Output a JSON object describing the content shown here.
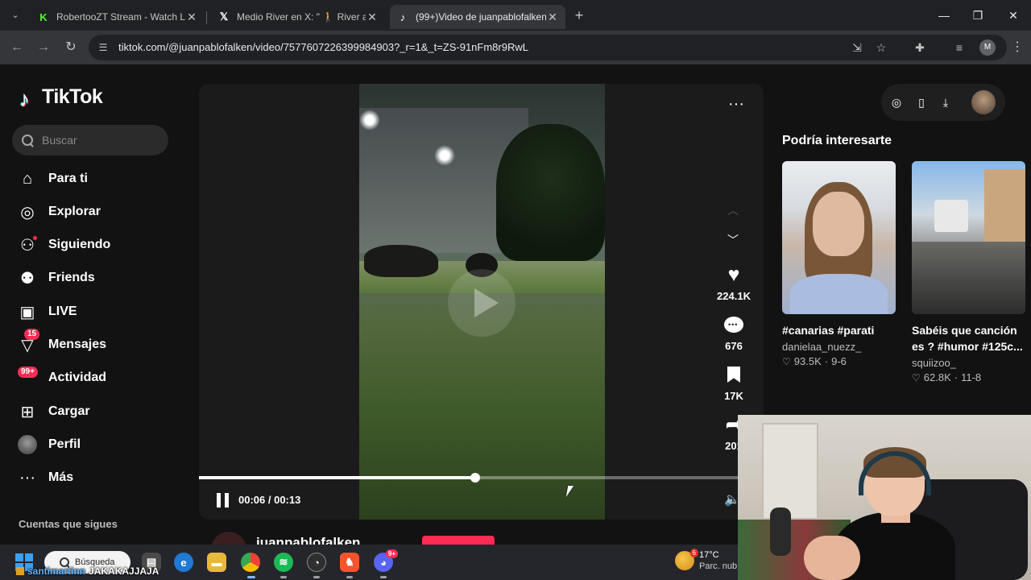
{
  "browser": {
    "tabs": [
      {
        "title": "RobertooZT Stream - Watch Liv",
        "icon": "kick-icon",
        "active": false
      },
      {
        "title": "Medio River en X: \" 🚶 River ave",
        "icon": "x-icon",
        "active": false
      },
      {
        "title": "(99+)Video de juanpablofalken",
        "icon": "tiktok-icon",
        "active": true
      }
    ],
    "url": "tiktok.com/@juanpablofalken/video/7577607226399984903?_r=1&_t=ZS-91nFm8r9RwL",
    "profile_initial": "M"
  },
  "tiktok": {
    "logo_text": "TikTok",
    "search_placeholder": "Buscar",
    "nav": [
      {
        "label": "Para ti",
        "icon": "home-icon"
      },
      {
        "label": "Explorar",
        "icon": "compass-icon"
      },
      {
        "label": "Siguiendo",
        "icon": "following-icon"
      },
      {
        "label": "Friends",
        "icon": "friends-icon"
      },
      {
        "label": "LIVE",
        "icon": "live-icon"
      },
      {
        "label": "Mensajes",
        "icon": "messages-icon",
        "badge": "15"
      },
      {
        "label": "Actividad",
        "icon": "activity-icon",
        "badge": "99+"
      },
      {
        "label": "Cargar",
        "icon": "upload-icon"
      },
      {
        "label": "Perfil",
        "icon": "profile-avatar"
      },
      {
        "label": "Más",
        "icon": "more-icon"
      }
    ],
    "following_heading": "Cuentas que sigues",
    "player": {
      "current_time": "00:06",
      "duration": "00:13",
      "time_display": "00:06 / 00:13",
      "progress": 0.49
    },
    "actions": {
      "likes": "224.1K",
      "comments": "676",
      "saves": "17K",
      "shares": "201"
    },
    "author": "juanpablofalken",
    "recommended_title": "Podría interesarte",
    "recommended": [
      {
        "title": "#canarias #parati",
        "user": "danielaa_nuezz_",
        "likes": "93.5K",
        "date": "9-6"
      },
      {
        "title": "Sabéis que canción es ? #humor #125c...",
        "user": "squiizoo_",
        "likes": "62.8K",
        "date": "11-8"
      }
    ]
  },
  "taskbar": {
    "search_label": "Búsqueda",
    "weather_temp": "17°C",
    "weather_desc": "Parc. nub",
    "weather_badge": "6",
    "discord_badge": "9+"
  },
  "stream_chat": {
    "user": "santimartinn",
    "message": "JAKAKAJJAJA"
  },
  "colors": {
    "accent": "#fe2c55",
    "background": "#121212"
  }
}
